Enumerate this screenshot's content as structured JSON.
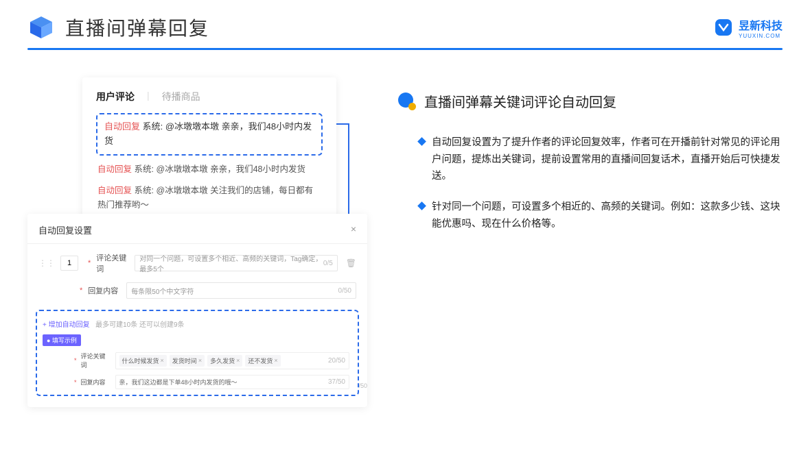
{
  "header": {
    "title": "直播间弹幕回复",
    "brand_name": "昱新科技",
    "brand_sub": "YUUXIN.COM"
  },
  "comments_panel": {
    "tab_active": "用户评论",
    "tab_sep": "|",
    "tab_inactive": "待播商品",
    "highlighted": {
      "label": "自动回复",
      "meta": "系统: @冰墩墩本墩 亲亲，我们48小时内发货"
    },
    "row2": {
      "label": "自动回复",
      "meta": "系统: @冰墩墩本墩 亲亲，我们48小时内发货"
    },
    "row3": {
      "label": "自动回复",
      "meta": "系统: @冰墩墩本墩 关注我们的店铺，每日都有热门推荐哟～"
    }
  },
  "settings_panel": {
    "title": "自动回复设置",
    "index": "1",
    "kw_label": "评论关键词",
    "kw_placeholder": "对同一个问题，可设置多个相近、高频的关键词，Tag确定，最多5个",
    "kw_counter": "0/5",
    "reply_label": "回复内容",
    "reply_placeholder": "每条限50个中文字符",
    "reply_counter": "0/50",
    "add_link": "+ 增加自动回复",
    "add_hint": "最多可建10条 还可以创建9条",
    "example_badge": "● 填写示例",
    "ex_kw_label": "评论关键词",
    "ex_tags": [
      "什么时候发货",
      "发货时间",
      "多久发货",
      "还不发货"
    ],
    "ex_kw_counter": "20/50",
    "ex_reply_label": "回复内容",
    "ex_reply_text": "亲，我们这边都是下单48小时内发货的哦～",
    "ex_reply_counter": "37/50",
    "extra_counter": "/50"
  },
  "right": {
    "title": "直播间弹幕关键词评论自动回复",
    "bullet1": "自动回复设置为了提升作者的评论回复效率，作者可在开播前针对常见的评论用户问题，提炼出关键词，提前设置常用的直播间回复话术，直播开始后可快捷发送。",
    "bullet2": "针对同一个问题，可设置多个相近的、高频的关键词。例如：这款多少钱、这块能优惠吗、现在什么价格等。"
  }
}
